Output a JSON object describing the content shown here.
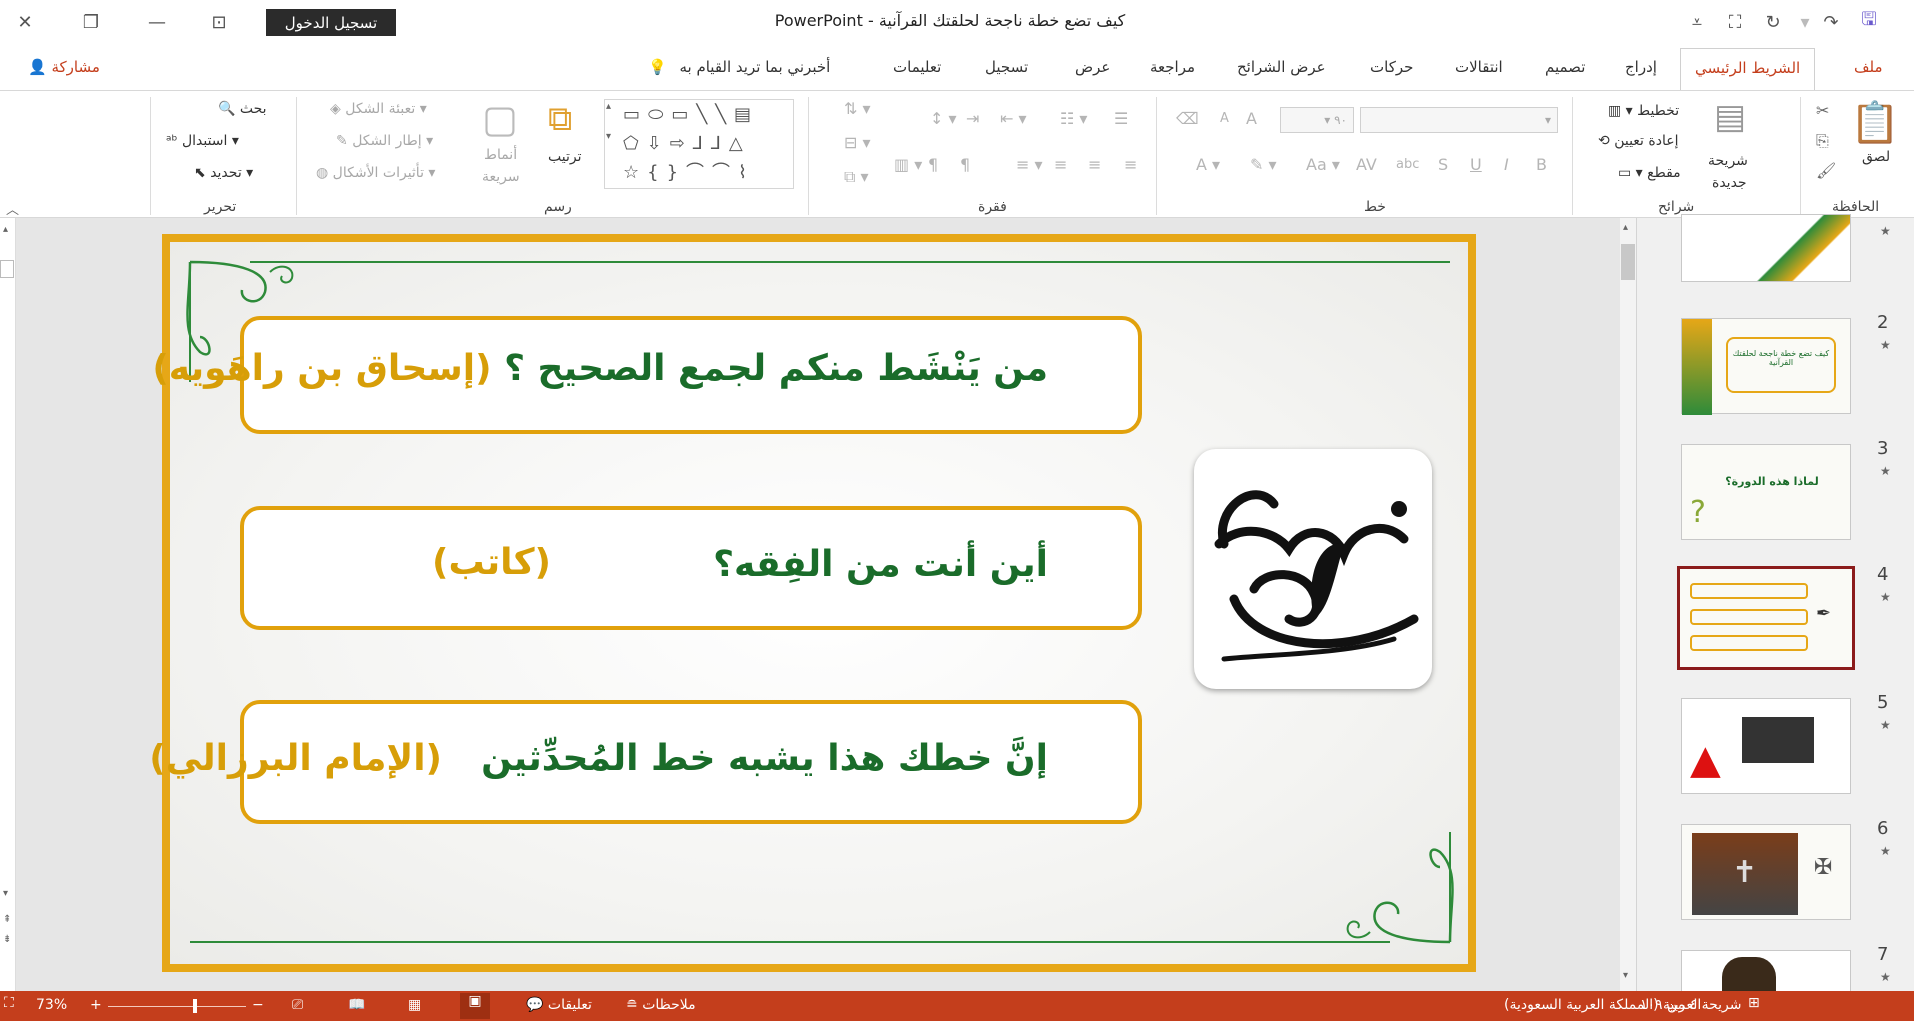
{
  "window": {
    "doc_name": "كيف تضع خطة ناجحة لحلقتك القرآنية",
    "app_name": "PowerPoint",
    "title_separator": "-",
    "sign_in": "تسجيل الدخول"
  },
  "tabs": [
    {
      "label": "ملف",
      "kind": "file"
    },
    {
      "label": "الشريط الرئيسي",
      "kind": "active"
    },
    {
      "label": "إدراج"
    },
    {
      "label": "تصميم"
    },
    {
      "label": "انتقالات"
    },
    {
      "label": "حركات"
    },
    {
      "label": "عرض الشرائح"
    },
    {
      "label": "مراجعة"
    },
    {
      "label": "عرض"
    },
    {
      "label": "تسجيل"
    },
    {
      "label": "تعليمات"
    },
    {
      "label": "أخبرني بما تريد القيام به"
    }
  ],
  "share": "مشاركة",
  "ribbon": {
    "clipboard": {
      "label": "الحافظة",
      "paste": "لصق"
    },
    "slides": {
      "label": "شرائح",
      "new_slide": "شريحة",
      "new_slide2": "جديدة",
      "layout": "تخطيط",
      "reset": "إعادة تعيين",
      "section": "مقطع"
    },
    "font": {
      "label": "خط"
    },
    "paragraph": {
      "label": "فقرة"
    },
    "drawing": {
      "label": "رسم",
      "arrange": "ترتيب",
      "quick_styles": "أنماط",
      "quick_styles2": "سريعة",
      "shape_fill": "تعبئة الشكل",
      "shape_outline": "إطار الشكل",
      "shape_effects": "تأثيرات الأشكال"
    },
    "editing": {
      "label": "تحرير",
      "find": "بحث",
      "replace": "استبدال",
      "select": "تحديد"
    }
  },
  "slide": {
    "q1_green": "من يَنْشَط منكم لجمع الصحيح ؟",
    "q1_gold": "(إسحاق بن راهَويه)",
    "q2_green": "أين أنت من الفِقه؟",
    "q2_gold": "(كاتب)",
    "q3_green": "إنَّ خطك هذا يشبه خط المُحدِّثين",
    "q3_gold": "(الإمام البرزالي)",
    "logo_alt": "صاحب رسالة"
  },
  "thumbnails": [
    {
      "num": "",
      "star": "★"
    },
    {
      "num": "2",
      "star": "★",
      "text": "كيف تضع خطة ناجحة لحلقتك القرآنية"
    },
    {
      "num": "3",
      "star": "★",
      "text": "لماذا هذه الدورة؟"
    },
    {
      "num": "4",
      "star": "★",
      "selected": true
    },
    {
      "num": "5",
      "star": "★"
    },
    {
      "num": "6",
      "star": "★"
    },
    {
      "num": "7",
      "star": "★"
    }
  ],
  "status": {
    "slide_counter": "شريحة ٤ من ١٠٩",
    "language": "العربية (المملكة العربية السعودية)",
    "notes": "ملاحظات",
    "comments": "تعليقات",
    "zoom": "73%",
    "zoom_minus": "−",
    "zoom_plus": "+",
    "zoom_level": 0.73
  },
  "colors": {
    "accent": "#c43e1c",
    "slide_frame": "#e6a717",
    "green_text": "#1a6c2a",
    "gold_text": "#d79e08"
  }
}
